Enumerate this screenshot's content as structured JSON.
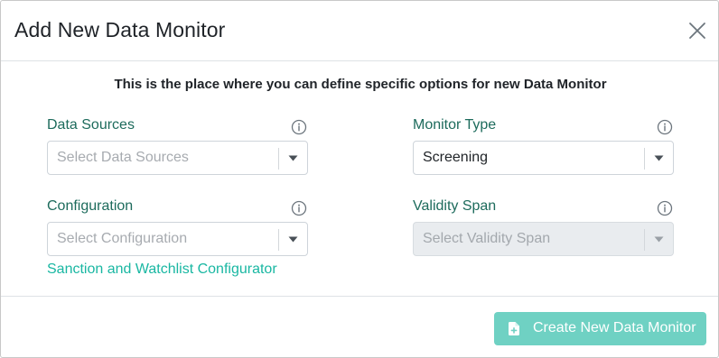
{
  "dialog": {
    "title": "Add New Data Monitor",
    "intro": "This is the place where you can define specific options for new Data Monitor"
  },
  "fields": {
    "data_sources": {
      "label": "Data Sources",
      "placeholder": "Select Data Sources"
    },
    "monitor_type": {
      "label": "Monitor Type",
      "value": "Screening"
    },
    "configuration": {
      "label": "Configuration",
      "placeholder": "Select Configuration"
    },
    "validity_span": {
      "label": "Validity Span",
      "placeholder": "Select Validity Span",
      "disabled": true
    }
  },
  "links": {
    "configurator": "Sanction and Watchlist Configurator"
  },
  "footer": {
    "create_label": "Create New Data Monitor"
  },
  "icons": {
    "close": "close-icon",
    "info": "info-icon",
    "caret": "chevron-down-icon",
    "file_add": "file-plus-icon"
  },
  "colors": {
    "label": "#1d6b5c",
    "link": "#19b7a2",
    "primary_button": "#6fd1c3"
  }
}
